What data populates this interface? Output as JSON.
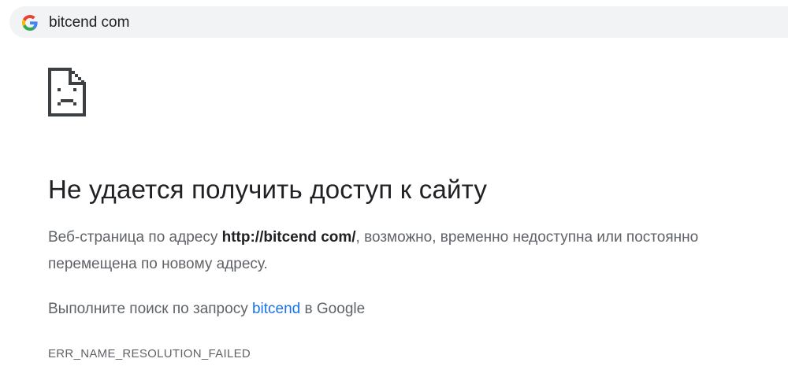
{
  "omnibox": {
    "url_text": "bitcend com",
    "icon": "google-g-icon"
  },
  "error_page": {
    "icon": "sad-page-icon",
    "title": "Не удается получить доступ к сайту",
    "desc_prefix": "Веб-страница по адресу ",
    "desc_url": "http://bitcend com/",
    "desc_suffix": ", возможно, временно недоступна или постоянно перемещена по новому адресу.",
    "suggest_prefix": "Выполните поиск по запросу ",
    "suggest_link": "bitcend",
    "suggest_suffix": " в Google",
    "error_code": "ERR_NAME_RESOLUTION_FAILED"
  },
  "colors": {
    "link": "#1a73e8",
    "text_primary": "#202124",
    "text_secondary": "#5f6368",
    "omnibox_bg": "#f1f3f4"
  }
}
